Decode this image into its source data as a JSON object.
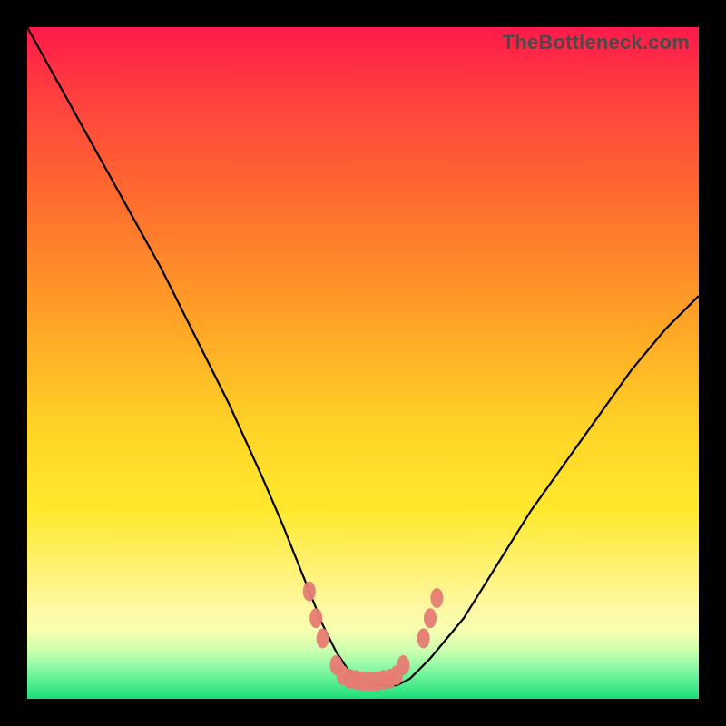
{
  "watermark": "TheBottleneck.com",
  "colors": {
    "frame": "#000000",
    "curve": "#000000",
    "marker": "#e77b73",
    "gradient_top": "#ff1a4a",
    "gradient_bottom": "#1bde78"
  },
  "chart_data": {
    "type": "line",
    "title": "",
    "xlabel": "",
    "ylabel": "",
    "xlim": [
      0,
      100
    ],
    "ylim": [
      0,
      100
    ],
    "series": [
      {
        "name": "bottleneck-curve",
        "x": [
          0,
          5,
          10,
          15,
          20,
          25,
          30,
          35,
          38,
          40,
          42,
          44,
          46,
          48,
          50,
          52,
          54,
          55,
          57,
          60,
          65,
          70,
          75,
          80,
          85,
          90,
          95,
          100
        ],
        "y": [
          100,
          91,
          82,
          73,
          64,
          54,
          44,
          33,
          26,
          21,
          16,
          11,
          7,
          4,
          3,
          2,
          2,
          2,
          3,
          6,
          12,
          20,
          28,
          35,
          42,
          49,
          55,
          60
        ]
      }
    ],
    "markers": {
      "name": "bottom-cluster",
      "points": [
        {
          "x": 42,
          "y": 16
        },
        {
          "x": 43,
          "y": 12
        },
        {
          "x": 44,
          "y": 9
        },
        {
          "x": 46,
          "y": 5
        },
        {
          "x": 47,
          "y": 3.5
        },
        {
          "x": 48,
          "y": 3
        },
        {
          "x": 49,
          "y": 2.8
        },
        {
          "x": 50,
          "y": 2.6
        },
        {
          "x": 51,
          "y": 2.6
        },
        {
          "x": 52,
          "y": 2.6
        },
        {
          "x": 53,
          "y": 2.8
        },
        {
          "x": 54,
          "y": 3
        },
        {
          "x": 55,
          "y": 3.5
        },
        {
          "x": 56,
          "y": 5
        },
        {
          "x": 59,
          "y": 9
        },
        {
          "x": 60,
          "y": 12
        },
        {
          "x": 61,
          "y": 15
        }
      ]
    }
  }
}
